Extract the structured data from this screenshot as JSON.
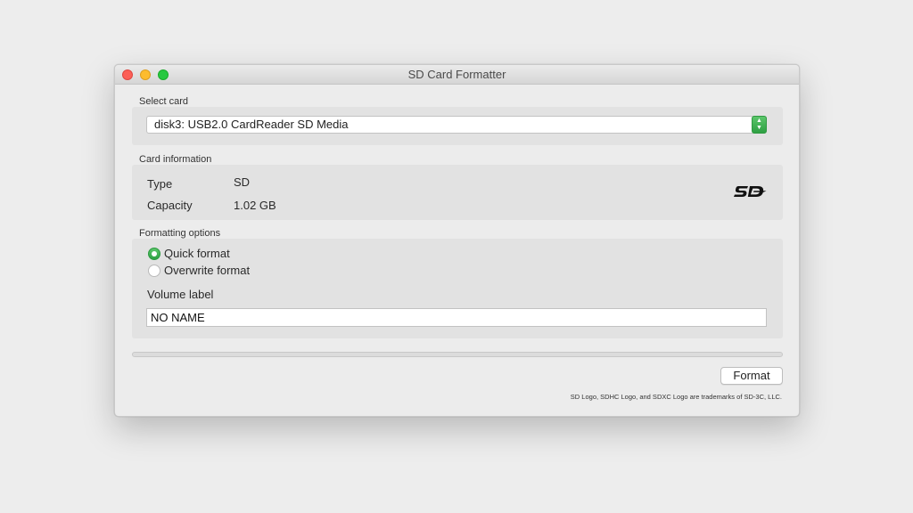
{
  "window": {
    "title": "SD Card Formatter"
  },
  "select_card": {
    "label": "Select card",
    "selected": "disk3: USB2.0 CardReader SD Media"
  },
  "card_info": {
    "label": "Card information",
    "type_label": "Type",
    "type_value": "SD",
    "capacity_label": "Capacity",
    "capacity_value": "1.02 GB",
    "logo_text": "SD",
    "logo_icon": "sd-logo-icon"
  },
  "formatting": {
    "label": "Formatting options",
    "options": [
      {
        "label": "Quick format",
        "selected": true
      },
      {
        "label": "Overwrite format",
        "selected": false
      }
    ],
    "volume_label_caption": "Volume label",
    "volume_label_value": "NO NAME"
  },
  "progress": {
    "fraction": 0
  },
  "actions": {
    "format_label": "Format"
  },
  "footer": {
    "trademark_note": "SD Logo, SDHC Logo, and SDXC Logo are trademarks of SD-3C, LLC."
  },
  "colors": {
    "accent_green": "#2ea043",
    "close": "#fc5f57",
    "minimize": "#fdbc2e",
    "maximize": "#28c840"
  }
}
